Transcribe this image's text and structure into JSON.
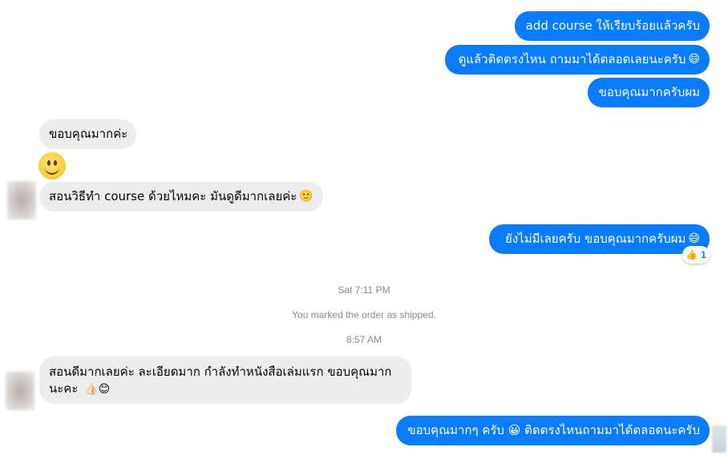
{
  "conversation": {
    "messages": [
      {
        "side": "out",
        "text": "add course ให้เรียบร้อยแล้วครับ",
        "emoji": ""
      },
      {
        "side": "out",
        "text": "ดูแล้วติดตรงไหน ถามมาได้ตลอดเลยนะครับ",
        "emoji": "😄"
      },
      {
        "side": "out",
        "text": "ขอบคุณมากครับผม",
        "emoji": ""
      },
      {
        "side": "in",
        "text": "ขอบคุณมากค่ะ",
        "emoji": ""
      },
      {
        "side": "in",
        "text": "",
        "emoji": "🙂"
      },
      {
        "side": "in",
        "text": "สอนวิธีทำ course ด้วยไหมคะ มันดูดีมากเลยค่ะ",
        "emoji": "🙂"
      },
      {
        "side": "out",
        "text": "ยังไม่มีเลยครับ ขอบคุณมากครับผม",
        "emoji": "😄",
        "reaction": {
          "icon": "👍",
          "count": "1"
        }
      },
      {
        "side": "in",
        "text": "สอนดีมากเลยค่ะ ละเอียดมาก กำลังทำหนังสือเล่มแรก ขอบคุณมาก นะคะ",
        "emoji": "👍🏻😊"
      },
      {
        "side": "out",
        "text": "ขอบคุณมากๆ ครับ 😀 ติดตรงไหนถามมาได้ตลอดนะครับ",
        "emoji": ""
      }
    ],
    "timestamps": {
      "first": "Sat 7:11 PM",
      "second": "8:57 AM"
    },
    "system_notice": "You marked the order as shipped."
  },
  "colors": {
    "outgoing_bubble": "#0a7cff",
    "incoming_bubble": "#ededed",
    "meta_text": "#8a8d91"
  }
}
